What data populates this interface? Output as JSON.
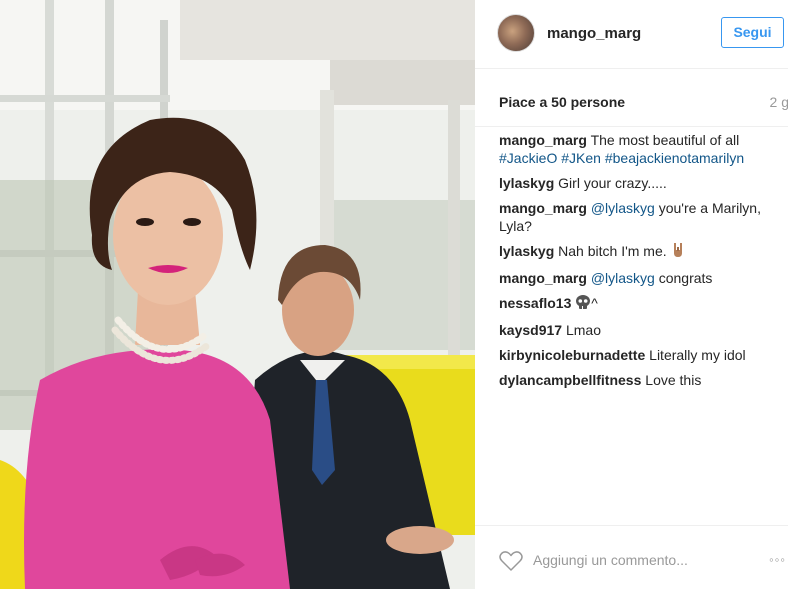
{
  "post": {
    "photo_description": "",
    "username": "mango_marg",
    "follow_label": "Segui",
    "likes": "Piace a 50 persone",
    "time": "2 g"
  },
  "comments": [
    {
      "user": "mango_marg",
      "text": "The most beautiful of all",
      "tags": "#JackieO #JKen #beajackienotamarilyn"
    },
    {
      "user": "lylaskyg",
      "text": "Girl your crazy....."
    },
    {
      "user": "mango_marg",
      "mention": "@lylaskyg",
      "text": "you're a Marilyn, Lyla?"
    },
    {
      "user": "lylaskyg",
      "text": "Nah bitch I'm me.",
      "emoji": "hand-horns-icon"
    },
    {
      "user": "mango_marg",
      "mention": "@lylaskyg",
      "text": "congrats"
    },
    {
      "user": "nessaflo13",
      "emoji": "skull-icon",
      "text": "^"
    },
    {
      "user": "kaysd917",
      "text": "Lmao"
    },
    {
      "user": "kirbynicoleburnadette",
      "text": "Literally my idol"
    },
    {
      "user": "dylancampbellfitness",
      "text": "Love this"
    }
  ],
  "footer": {
    "add_comment_placeholder": "Aggiungi un commento...",
    "more_label": "◦◦◦"
  },
  "colors": {
    "accent": "#3897f0",
    "tag": "#125688",
    "muted": "#999999"
  }
}
